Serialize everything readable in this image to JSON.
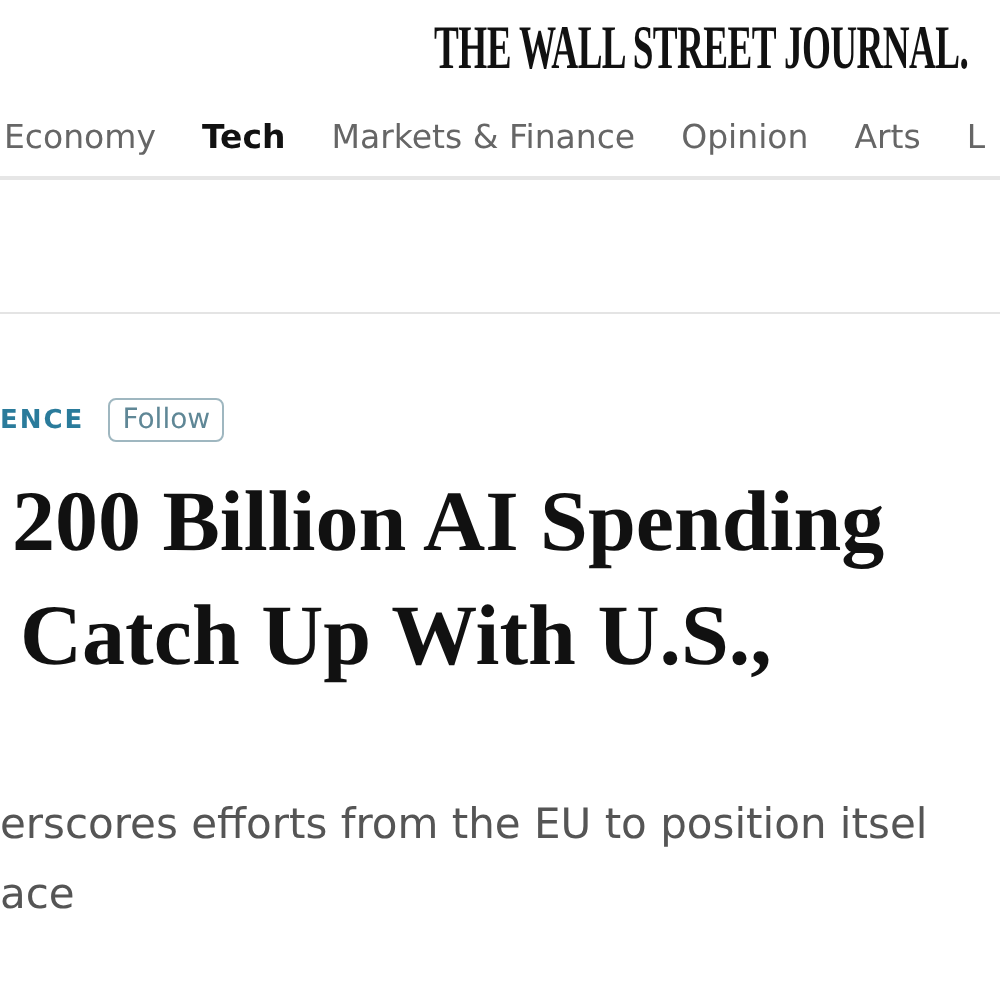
{
  "masthead": {
    "logo": "THE WALL STREET JOURNAL."
  },
  "nav": [
    {
      "label": "Economy",
      "selected": false
    },
    {
      "label": "Tech",
      "selected": true
    },
    {
      "label": "Markets & Finance",
      "selected": false
    },
    {
      "label": "Opinion",
      "selected": false
    },
    {
      "label": "Arts",
      "selected": false
    },
    {
      "label": "L",
      "selected": false
    }
  ],
  "article": {
    "topic": "ENCE",
    "follow_button": "Follow",
    "headline": [
      "200 Billion AI Spending",
      "Catch Up With U.S.,"
    ],
    "deck": [
      "erscores efforts from the EU to position itsel",
      "ace"
    ]
  }
}
